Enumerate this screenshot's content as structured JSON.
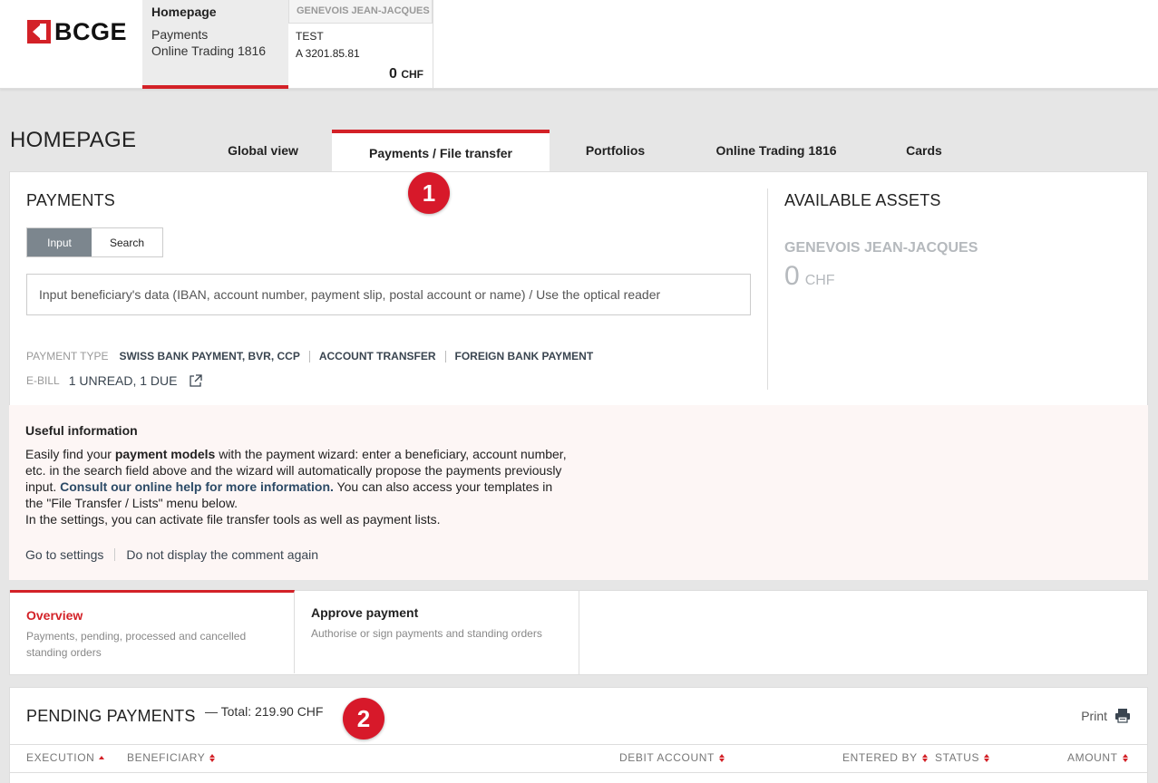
{
  "brand": {
    "logo_text": "BCGE",
    "accent": "#d32127"
  },
  "topnav": {
    "home": {
      "title": "Homepage",
      "links": [
        "Payments",
        "Online Trading 1816"
      ]
    },
    "account": {
      "holder": "GENEVOIS JEAN-JACQUES",
      "name": "TEST",
      "number": "A 3201.85.81",
      "balance": "0",
      "currency": "CHF"
    }
  },
  "page": {
    "title": "HOMEPAGE",
    "tabs": [
      {
        "label": "Global view",
        "active": false
      },
      {
        "label": "Payments / File transfer",
        "active": true
      },
      {
        "label": "Portfolios",
        "active": false
      },
      {
        "label": "Online Trading 1816",
        "active": false
      },
      {
        "label": "Cards",
        "active": false
      }
    ]
  },
  "payments": {
    "title": "PAYMENTS",
    "toggle": {
      "input": "Input",
      "search": "Search"
    },
    "search_placeholder": "Input beneficiary's data (IBAN, account number, payment slip, postal account or name) / Use the optical reader",
    "payment_type_label": "PAYMENT TYPE",
    "payment_types": [
      "SWISS BANK PAYMENT, BVR, CCP",
      "ACCOUNT TRANSFER",
      "FOREIGN BANK PAYMENT"
    ],
    "ebill_label": "E-BILL",
    "ebill_value": "1 UNREAD, 1 DUE"
  },
  "assets": {
    "title": "AVAILABLE ASSETS",
    "holder": "GENEVOIS JEAN-JACQUES",
    "amount": "0",
    "currency": "CHF"
  },
  "info": {
    "title": "Useful information",
    "text_1": "Easily find your ",
    "text_bold": "payment models",
    "text_2": " with the payment wizard: enter a beneficiary, account number, etc. in the search field above and the wizard will automatically propose the payments previously input. ",
    "text_link": "Consult our online help for more information.",
    "text_3": " You can also access your templates in the \"File Transfer / Lists\" menu below.",
    "text_4": "In the settings, you can activate file transfer tools as well as payment lists.",
    "action_settings": "Go to settings",
    "action_dismiss": "Do not display the comment again"
  },
  "subtabs": [
    {
      "title": "Overview",
      "desc": "Payments, pending, processed and cancelled standing orders",
      "active": true
    },
    {
      "title": "Approve payment",
      "desc": "Authorise or sign payments and standing orders",
      "active": false
    }
  ],
  "pending": {
    "title": "PENDING PAYMENTS",
    "total": "— Total: 219.90 CHF",
    "print": "Print",
    "columns": [
      "EXECUTION",
      "BENEFICIARY",
      "DEBIT ACCOUNT",
      "ENTERED BY",
      "STATUS",
      "AMOUNT"
    ]
  },
  "callouts": [
    "1",
    "2"
  ]
}
